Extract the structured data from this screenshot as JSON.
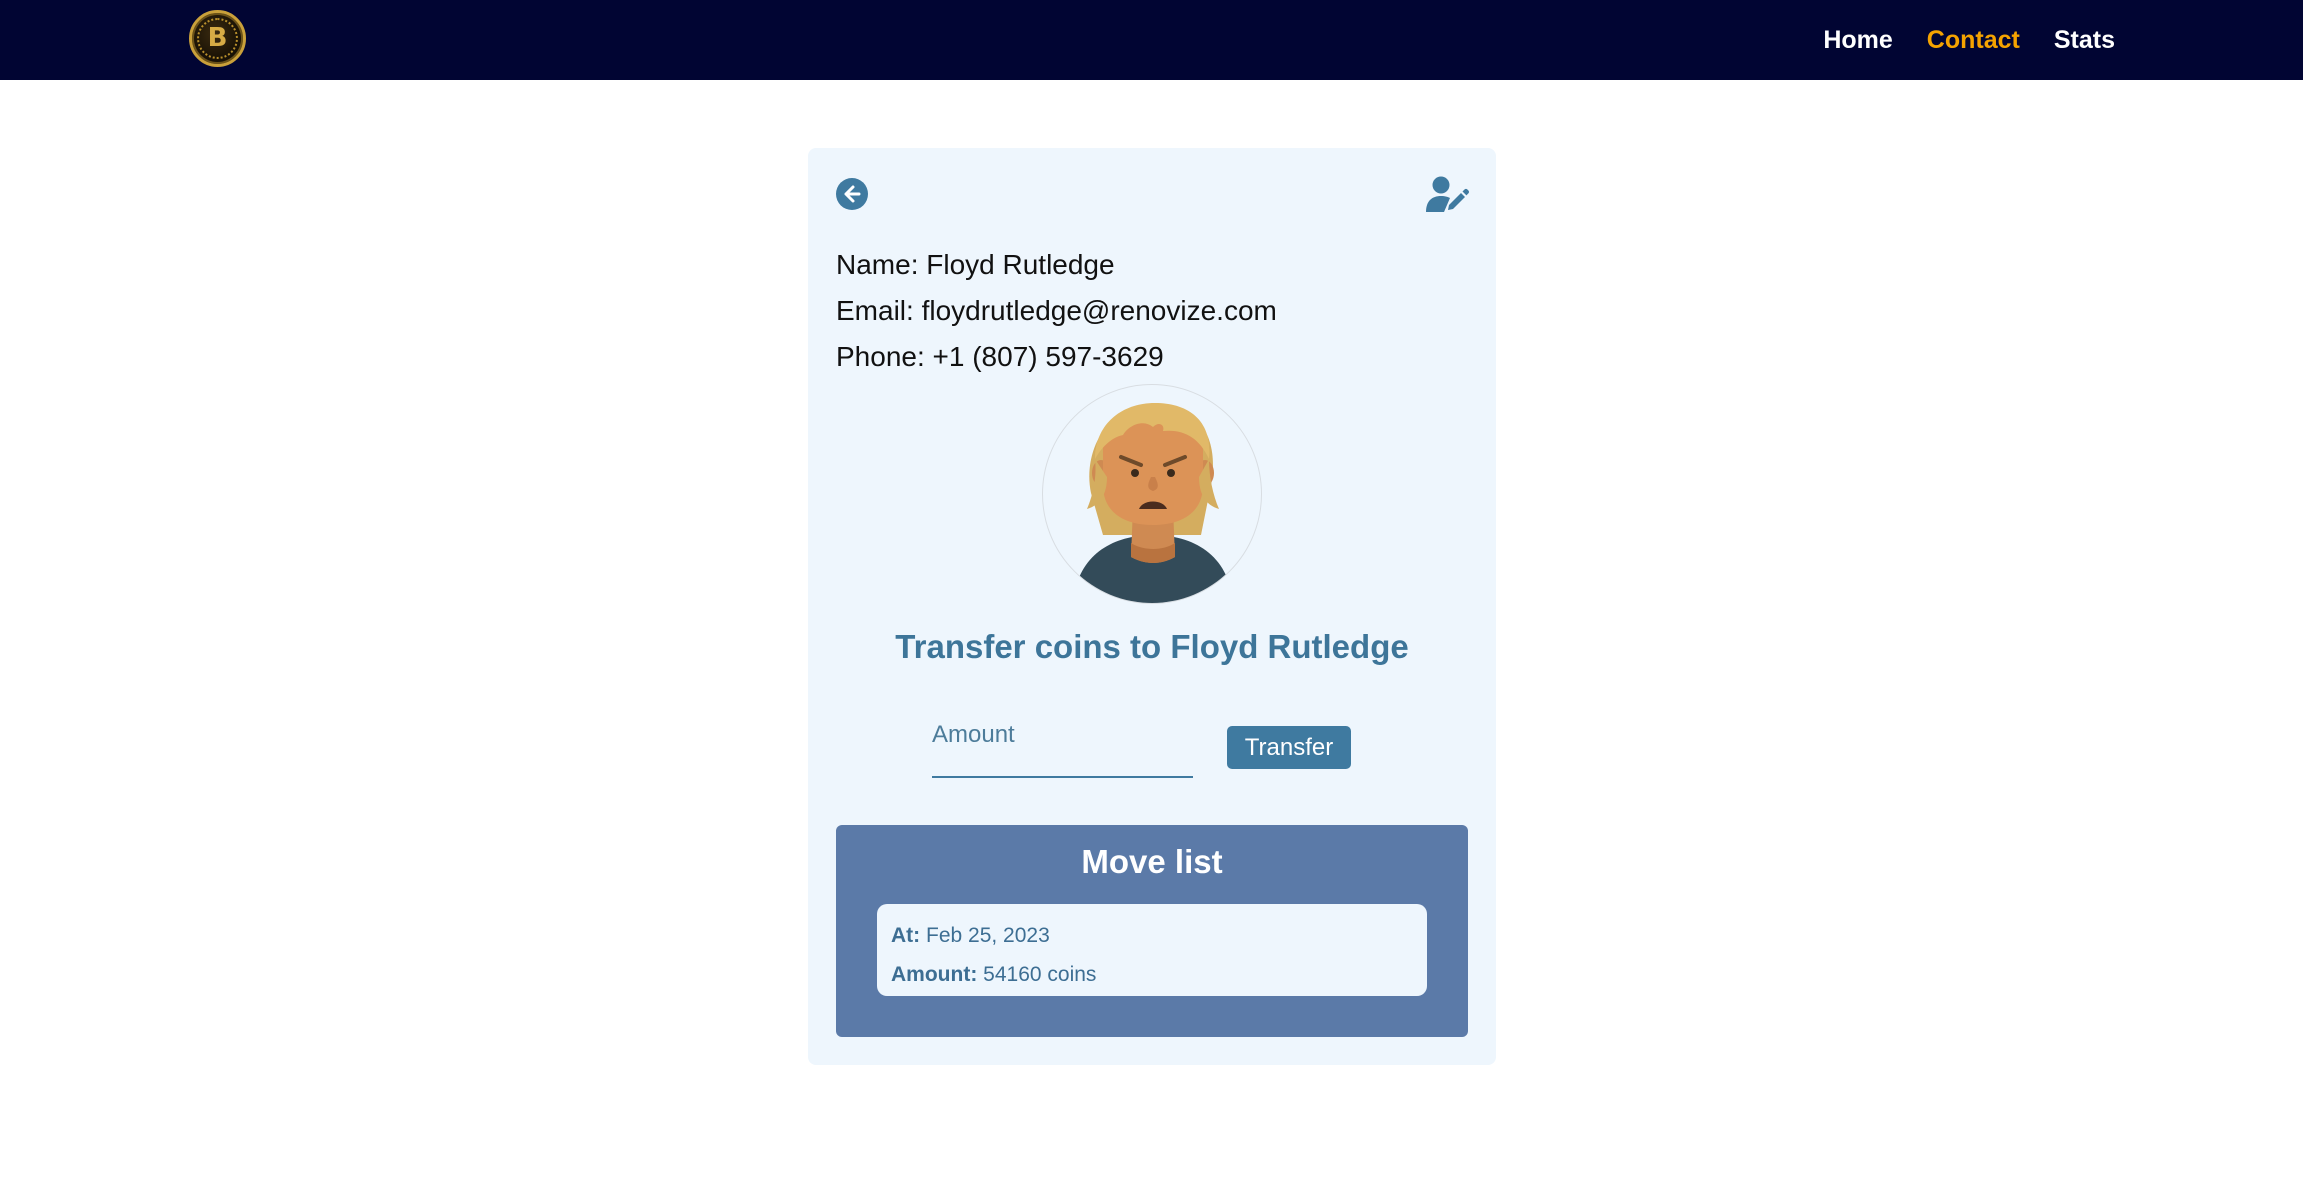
{
  "nav": {
    "logo_glyph": "B",
    "links": [
      {
        "label": "Home",
        "active": false
      },
      {
        "label": "Contact",
        "active": true
      },
      {
        "label": "Stats",
        "active": false
      }
    ]
  },
  "contact": {
    "name_label": "Name:",
    "name": "Floyd Rutledge",
    "email_label": "Email:",
    "email": "floydrutledge@renovize.com",
    "phone_label": "Phone:",
    "phone": "+1 (807) 597-3629"
  },
  "icons": {
    "back": "arrow-left-circle-icon",
    "edit": "user-edit-icon"
  },
  "transfer": {
    "title": "Transfer coins to Floyd Rutledge",
    "amount_placeholder": "Amount",
    "amount_value": "",
    "button_label": "Transfer"
  },
  "moves": {
    "title": "Move list",
    "items": [
      {
        "at_label": "At:",
        "at": "Feb 25, 2023",
        "amount_label": "Amount:",
        "amount": "54160 coins"
      }
    ]
  },
  "colors": {
    "navbar_bg": "#010533",
    "nav_active": "#f5a300",
    "card_bg": "#eef6fd",
    "accent": "#3f7aa0",
    "moves_bg": "#5b7aa8"
  }
}
